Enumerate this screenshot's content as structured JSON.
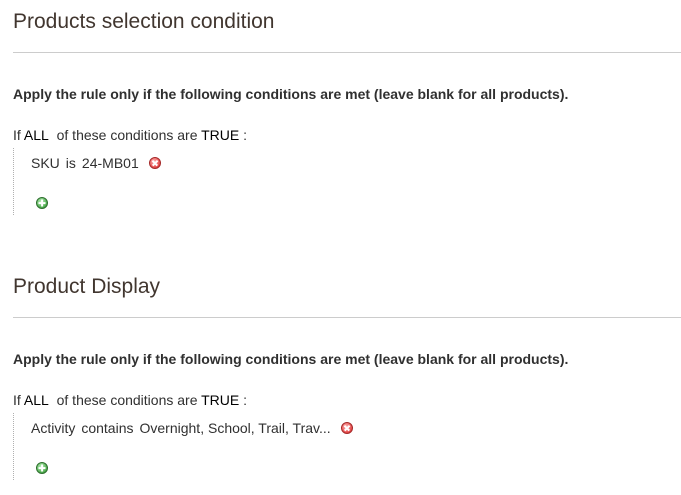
{
  "sections": [
    {
      "title": "Products selection condition",
      "apply_text": "Apply the rule only if the following conditions are met (leave blank for all products).",
      "if_prefix": "If",
      "aggregator": "ALL",
      "of_these": "of these conditions are",
      "value": "TRUE",
      "colon": ":",
      "condition": {
        "attribute": "SKU",
        "operator": "is",
        "value": "24-MB01"
      }
    },
    {
      "title": "Product Display",
      "apply_text": "Apply the rule only if the following conditions are met (leave blank for all products).",
      "if_prefix": "If",
      "aggregator": "ALL",
      "of_these": "of these conditions are",
      "value": "TRUE",
      "colon": ":",
      "condition": {
        "attribute": "Activity",
        "operator": "contains",
        "value": "Overnight, School, Trail, Trav..."
      }
    }
  ],
  "icons": {
    "remove": "remove-condition-icon",
    "add": "add-condition-icon"
  }
}
